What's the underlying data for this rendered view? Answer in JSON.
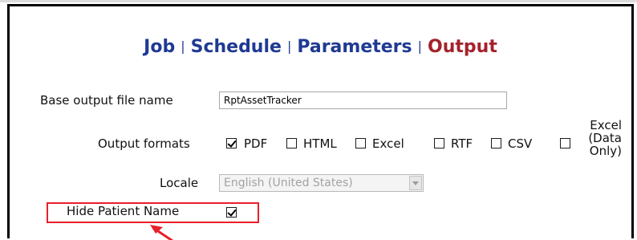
{
  "tabs": [
    {
      "label": "Job",
      "active": false
    },
    {
      "label": "Schedule",
      "active": false
    },
    {
      "label": "Parameters",
      "active": false
    },
    {
      "label": "Output",
      "active": true
    }
  ],
  "tab_separator": "|",
  "form": {
    "base_output_label": "Base output file name",
    "base_output_value": "RptAssetTracker",
    "output_formats_label": "Output formats",
    "formats": [
      {
        "label": "PDF",
        "checked": true
      },
      {
        "label": "HTML",
        "checked": false
      },
      {
        "label": "Excel",
        "checked": false
      },
      {
        "label": "RTF",
        "checked": false
      },
      {
        "label": "CSV",
        "checked": false
      },
      {
        "label": "Excel (Data Only)",
        "checked": false
      }
    ],
    "locale_label": "Locale",
    "locale_value": "English (United States)",
    "hide_patient_label": "Hide Patient Name",
    "hide_patient_checked": true
  },
  "colors": {
    "tab_link": "#1f3a93",
    "tab_active": "#a4222b",
    "highlight": "#e8202a"
  }
}
